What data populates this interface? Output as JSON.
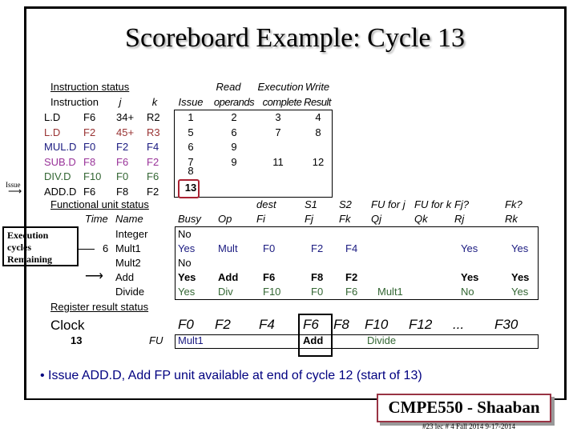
{
  "title": "Scoreboard Example:  Cycle 13",
  "colors": {
    "black": "#000000",
    "red": "#993333",
    "blue": "#1a1a80",
    "magenta": "#993399",
    "green": "#336633"
  },
  "instruction_status": {
    "label": "Instruction status",
    "headers": {
      "instruction": "Instruction",
      "j": "j",
      "k": "k",
      "issue": "Issue",
      "read_top": "Read",
      "read_bottom": "operands",
      "exec_top": "Execution",
      "exec_bottom": "complete",
      "write_top": "Write",
      "write_bottom": "Result"
    },
    "rows": [
      {
        "op": "L.D",
        "dest": "F6",
        "j": "34+",
        "k": "R2",
        "issue": "1",
        "read": "2",
        "exec": "3",
        "write": "4",
        "color": "blk"
      },
      {
        "op": "L.D",
        "dest": "F2",
        "j": "45+",
        "k": "R3",
        "issue": "5",
        "read": "6",
        "exec": "7",
        "write": "8",
        "color": "red"
      },
      {
        "op": "MUL.D",
        "dest": "F0",
        "j": "F2",
        "k": "F4",
        "issue": "6",
        "read": "9",
        "exec": "",
        "write": "",
        "color": "blu"
      },
      {
        "op": "SUB.D",
        "dest": "F8",
        "j": "F6",
        "k": "F2",
        "issue": "7",
        "read": "9",
        "exec": "11",
        "write": "12",
        "color": "mag"
      },
      {
        "op": "DIV.D",
        "dest": "F10",
        "j": "F0",
        "k": "F6",
        "issue": "8",
        "read": "",
        "exec": "",
        "write": "",
        "color": "grn"
      },
      {
        "op": "ADD.D",
        "dest": "F6",
        "j": "F8",
        "k": "F2",
        "issue": "13",
        "read": "",
        "exec": "",
        "write": "",
        "color": "blk"
      }
    ],
    "issue_arrow_label": "Issue"
  },
  "fu_status": {
    "label": "Functional unit status",
    "headers_top": {
      "fi": "dest",
      "fj": "S1",
      "fk": "S2",
      "qj": "FU for j",
      "qk": "FU for k",
      "rj": "Fj?",
      "rk": "Fk?"
    },
    "headers": {
      "time": "Time",
      "name": "Name",
      "busy": "Busy",
      "op": "Op",
      "fi": "Fi",
      "fj": "Fj",
      "fk": "Fk",
      "qj": "Qj",
      "qk": "Qk",
      "rj": "Rj",
      "rk": "Rk"
    },
    "rows": [
      {
        "time": "",
        "name": "Integer",
        "busy": "No",
        "op": "",
        "fi": "",
        "fj": "",
        "fk": "",
        "qj": "",
        "qk": "",
        "rj": "",
        "rk": "",
        "color": "blk"
      },
      {
        "time": "6",
        "name": "Mult1",
        "busy": "Yes",
        "op": "Mult",
        "fi": "F0",
        "fj": "F2",
        "fk": "F4",
        "qj": "",
        "qk": "",
        "rj": "Yes",
        "rk": "Yes",
        "color": "blu"
      },
      {
        "time": "",
        "name": "Mult2",
        "busy": "No",
        "op": "",
        "fi": "",
        "fj": "",
        "fk": "",
        "qj": "",
        "qk": "",
        "rj": "",
        "rk": "",
        "color": "blk"
      },
      {
        "time": "",
        "name": "Add",
        "busy": "Yes",
        "op": "Add",
        "fi": "F6",
        "fj": "F8",
        "fk": "F2",
        "qj": "",
        "qk": "",
        "rj": "Yes",
        "rk": "Yes",
        "color": "blk"
      },
      {
        "time": "",
        "name": "Divide",
        "busy": "Yes",
        "op": "Div",
        "fi": "F10",
        "fj": "F0",
        "fk": "F6",
        "qj": "Mult1",
        "qk": "",
        "rj": "No",
        "rk": "Yes",
        "color": "grn"
      }
    ],
    "exec_note": "Execution cycles Remaining"
  },
  "register_status": {
    "label": "Register result status",
    "clock_label": "Clock",
    "clock_value": "13",
    "fu_label": "FU",
    "registers": [
      "F0",
      "F2",
      "F4",
      "F6",
      "F8",
      "F10",
      "F12",
      "...",
      "F30"
    ],
    "values": [
      "Mult1",
      "",
      "",
      "Add",
      "",
      "Divide",
      "",
      "",
      ""
    ]
  },
  "note": "• Issue ADD.D,  Add FP unit available at end of cycle 12 (start of 13)",
  "footer": {
    "course": "CMPE550 - Shaaban",
    "info": "#23   lec # 4 Fall 2014    9-17-2014"
  }
}
